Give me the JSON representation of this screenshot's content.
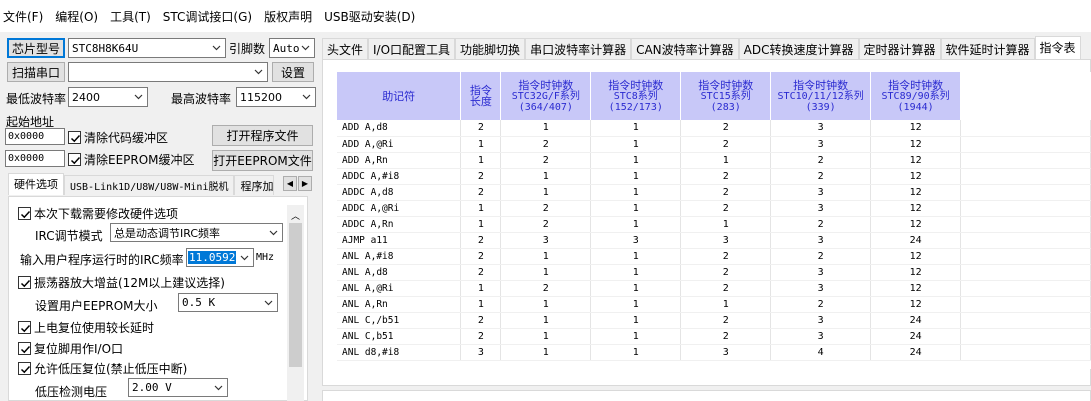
{
  "menu": [
    "文件(F)",
    "编程(O)",
    "工具(T)",
    "STC调试接口(G)",
    "版权声明",
    "USB驱动安装(D)"
  ],
  "left": {
    "chip_button": "芯片型号",
    "chip_value": "STC8H8K64U",
    "pin_label": "引脚数",
    "pin_value": "Auto",
    "scan_button": "扫描串口",
    "port_value": "",
    "settings_button": "设置",
    "min_baud_label": "最低波特率",
    "min_baud_value": "2400",
    "max_baud_label": "最高波特率",
    "max_baud_value": "115200",
    "start_addr_label": "起始地址",
    "addr1": "0x0000",
    "clear_code_label": "清除代码缓冲区",
    "open_prog_button": "打开程序文件",
    "addr2": "0x0000",
    "clear_eeprom_label": "清除EEPROM缓冲区",
    "open_eeprom_button": "打开EEPROM文件",
    "tabs": [
      "硬件选项",
      "USB-Link1D/U8W/U8W-Mini脱机",
      "程序加"
    ],
    "options": {
      "modify_hw": "本次下载需要修改硬件选项",
      "irc_mode_label": "IRC调节模式",
      "irc_mode_value": "总是动态调节IRC频率",
      "irc_freq_label": "输入用户程序运行时的IRC频率",
      "irc_freq_value": "11.0592",
      "irc_unit": "MHz",
      "osc_gain": "振荡器放大增益(12M以上建议选择)",
      "eeprom_size_label": "设置用户EEPROM大小",
      "eeprom_size_value": "0.5 K",
      "power_delay": "上电复位使用较长延时",
      "reset_io": "复位脚用作I/O口",
      "lvr": "允许低压复位(禁止低压中断)",
      "lvd_label": "低压检测电压",
      "lvd_value": "2.00 V"
    }
  },
  "right_tabs": [
    "头文件",
    "I/O口配置工具",
    "功能脚切换",
    "串口波特率计算器",
    "CAN波特率计算器",
    "ADC转换速度计算器",
    "定时器计算器",
    "软件延时计算器",
    "指令表"
  ],
  "table": {
    "headers": [
      [
        "助记符"
      ],
      [
        "指令",
        "长度"
      ],
      [
        "指令时钟数",
        "STC32G/F系列",
        "(364/407)"
      ],
      [
        "指令时钟数",
        "STC8系列",
        "(152/173)"
      ],
      [
        "指令时钟数",
        "STC15系列",
        "(283)"
      ],
      [
        "指令时钟数",
        "STC10/11/12系列",
        "(339)"
      ],
      [
        "指令时钟数",
        "STC89/90系列",
        "(1944)"
      ]
    ],
    "rows": [
      [
        "ADD A,d8",
        "2",
        "1",
        "1",
        "2",
        "3",
        "12"
      ],
      [
        "ADD A,@Ri",
        "1",
        "2",
        "1",
        "2",
        "3",
        "12"
      ],
      [
        "ADD A,Rn",
        "1",
        "2",
        "1",
        "1",
        "2",
        "12"
      ],
      [
        "ADDC A,#i8",
        "2",
        "1",
        "1",
        "2",
        "2",
        "12"
      ],
      [
        "ADDC A,d8",
        "2",
        "1",
        "1",
        "2",
        "3",
        "12"
      ],
      [
        "ADDC A,@Ri",
        "1",
        "2",
        "1",
        "2",
        "3",
        "12"
      ],
      [
        "ADDC A,Rn",
        "1",
        "2",
        "1",
        "1",
        "2",
        "12"
      ],
      [
        "AJMP a11",
        "2",
        "3",
        "3",
        "3",
        "3",
        "24"
      ],
      [
        "ANL A,#i8",
        "2",
        "1",
        "1",
        "2",
        "2",
        "12"
      ],
      [
        "ANL A,d8",
        "2",
        "1",
        "1",
        "2",
        "3",
        "12"
      ],
      [
        "ANL A,@Ri",
        "1",
        "2",
        "1",
        "2",
        "3",
        "12"
      ],
      [
        "ANL A,Rn",
        "1",
        "1",
        "1",
        "1",
        "2",
        "12"
      ],
      [
        "ANL C,/b51",
        "2",
        "1",
        "1",
        "2",
        "3",
        "24"
      ],
      [
        "ANL C,b51",
        "2",
        "1",
        "1",
        "2",
        "3",
        "24"
      ],
      [
        "ANL d8,#i8",
        "3",
        "1",
        "1",
        "3",
        "4",
        "24"
      ]
    ]
  }
}
